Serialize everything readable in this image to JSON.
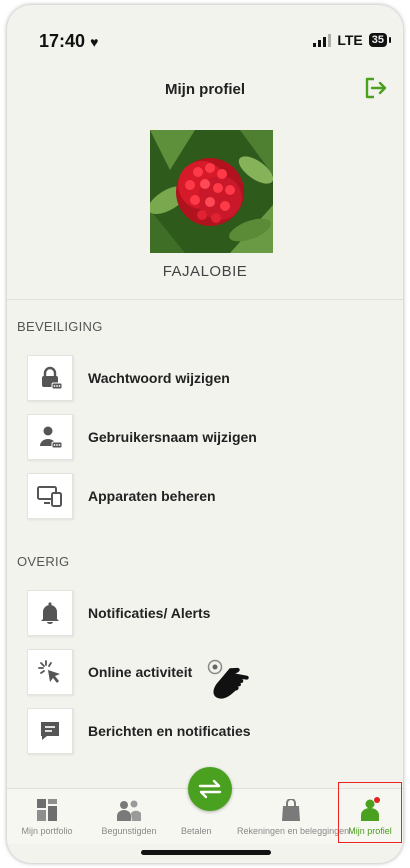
{
  "status_bar": {
    "time": "17:40",
    "network": "LTE",
    "battery": "35"
  },
  "header": {
    "title": "Mijn profiel"
  },
  "profile": {
    "username": "FAJALOBIE"
  },
  "sections": [
    {
      "label": "BEVEILIGING",
      "items": [
        {
          "label": "Wachtwoord wijzigen",
          "icon": "lock-icon"
        },
        {
          "label": "Gebruikersnaam wijzigen",
          "icon": "user-key-icon"
        },
        {
          "label": "Apparaten beheren",
          "icon": "devices-icon"
        }
      ]
    },
    {
      "label": "OVERIG",
      "items": [
        {
          "label": "Notificaties/ Alerts",
          "icon": "bell-icon"
        },
        {
          "label": "Online activiteit",
          "icon": "cursor-click-icon"
        },
        {
          "label": "Berichten en notificaties",
          "icon": "message-icon"
        }
      ]
    }
  ],
  "bottom_nav": [
    {
      "label": "Mijn portfolio",
      "icon": "portfolio-icon"
    },
    {
      "label": "Begunstigden",
      "icon": "beneficiaries-icon"
    },
    {
      "label": "Betalen",
      "icon": "transfer-icon"
    },
    {
      "label": "Rekeningen en beleggingen",
      "icon": "bag-icon"
    },
    {
      "label": "Mijn profiel",
      "icon": "profile-icon",
      "active": true
    }
  ],
  "colors": {
    "accent": "#4aa11f",
    "highlight": "#e22222",
    "background": "#f3f3ee"
  }
}
